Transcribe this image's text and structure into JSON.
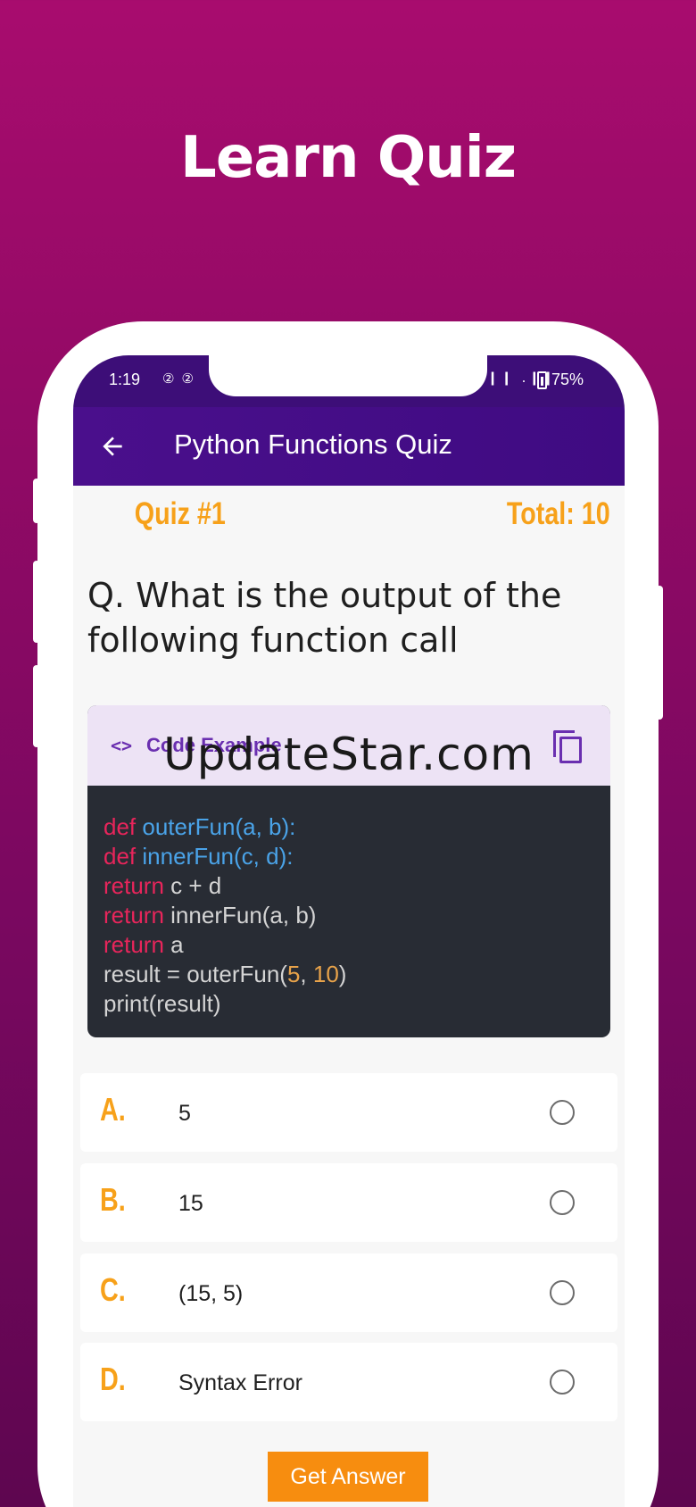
{
  "promo": {
    "title": "Learn Quiz"
  },
  "status_bar": {
    "time": "1:19",
    "notifications": "②②",
    "signals": ".❙❙ .❙❙",
    "battery": "75%"
  },
  "app_bar": {
    "title": "Python Functions Quiz",
    "back_icon": "arrow-left-icon"
  },
  "quiz": {
    "number_label": "Quiz #1",
    "total_label": "Total: 10"
  },
  "question": {
    "text": "Q. What is the output of the following function call"
  },
  "code_card": {
    "header_icon": "<>",
    "header_label": "Code Example",
    "copy_icon": "copy-icon",
    "watermark": "UpdateStar.com",
    "lines": [
      {
        "kw": "def",
        "fn": "outerFun(a, b):"
      },
      {
        "kw": "def",
        "fn": "innerFun(c, d):"
      },
      {
        "kw": "return",
        "rest": "c + d"
      },
      {
        "kw": "return",
        "rest": "innerFun(a, b)"
      },
      {
        "kw": "return",
        "rest": "a"
      },
      {
        "pre": "result = outerFun(",
        "n1": "5",
        "sep": ", ",
        "n2": "10",
        "post": ")"
      },
      {
        "rest": "print(result)"
      }
    ]
  },
  "options": [
    {
      "letter": "A.",
      "text": "5"
    },
    {
      "letter": "B.",
      "text": "15"
    },
    {
      "letter": "C.",
      "text": "(15, 5)"
    },
    {
      "letter": "D.",
      "text": "Syntax Error"
    }
  ],
  "actions": {
    "get_answer": "Get Answer"
  },
  "colors": {
    "accent_orange": "#f7a11a",
    "app_bar_purple": "#4a0f8c",
    "background_magenta": "#a80c6e",
    "button_orange": "#f78d0f"
  }
}
